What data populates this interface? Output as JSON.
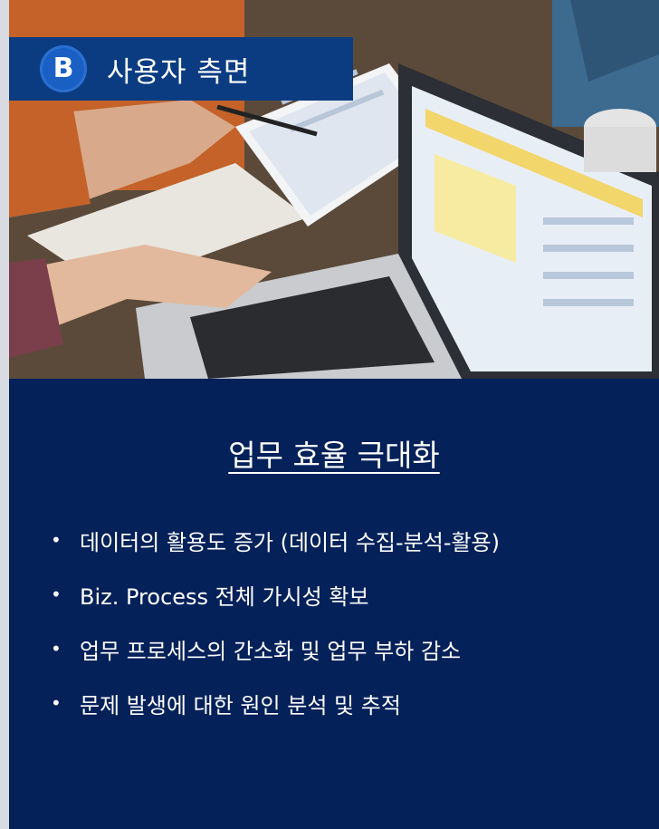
{
  "header": {
    "logo_letter": "B",
    "title": "사용자 측면"
  },
  "panel": {
    "title": "업무 효율 극대화",
    "bullet_symbol": "•",
    "bullets": [
      "데이터의 활용도 증가 (데이터 수집-분석-활용)",
      "Biz. Process 전체 가시성 확보",
      "업무 프로세스의 간소화 및 업무 부하 감소",
      "문제 발생에 대한 원인 분석 및 추적"
    ]
  },
  "colors": {
    "header_bar": "#0b3c82",
    "panel_bg": "#05215a",
    "logo_bg": "#1a5fc4"
  }
}
